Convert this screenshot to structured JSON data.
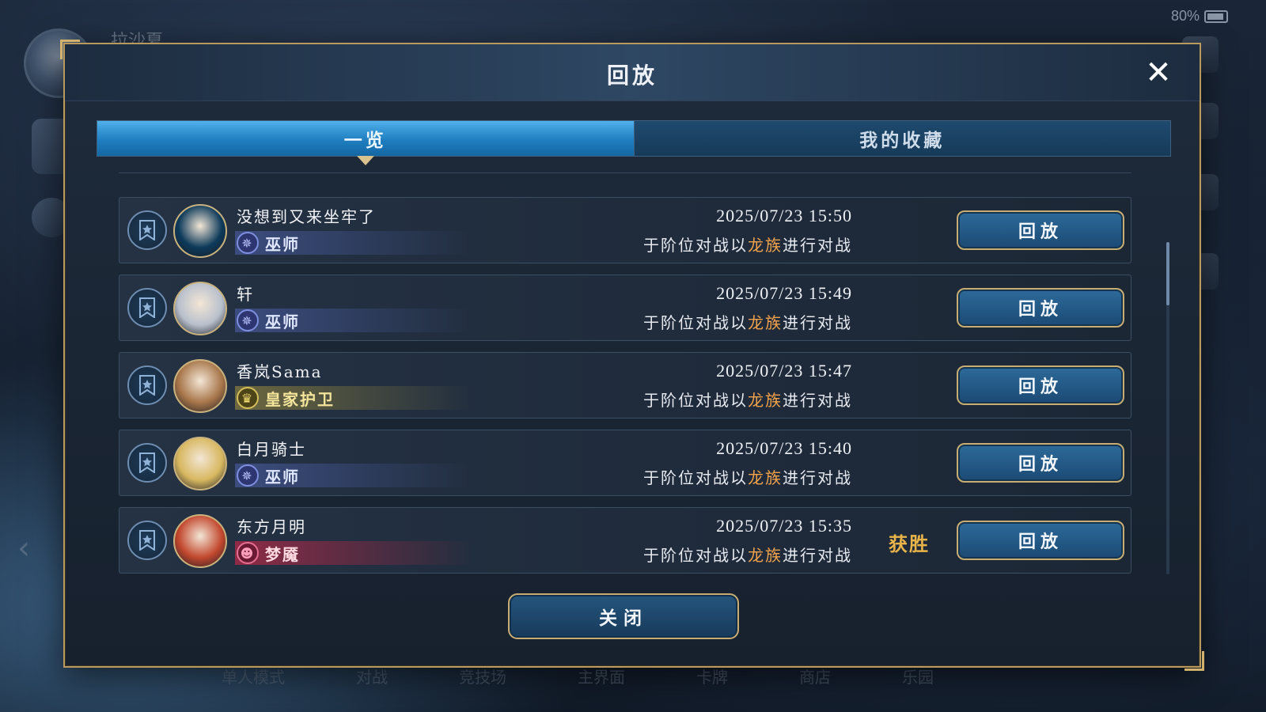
{
  "status": {
    "battery": "80%"
  },
  "background": {
    "username": "拉沙夏",
    "nav": [
      "单人模式",
      "对战",
      "竞技场",
      "主界面",
      "卡牌",
      "商店",
      "乐园"
    ]
  },
  "dialog": {
    "title": "回放",
    "close_icon": "close-icon",
    "tabs": [
      {
        "label": "一览",
        "active": true
      },
      {
        "label": "我的收藏",
        "active": false
      }
    ],
    "rows": [
      {
        "player": "没想到又来坐牢了",
        "class_name": "巫师",
        "class_type": "wizard",
        "datetime": "2025/07/23  15:50",
        "desc_prefix": "于阶位对战以",
        "deck": "龙族",
        "desc_suffix": "进行对战",
        "result": "",
        "replay_label": "回放",
        "portrait_color": "#0d3a5a"
      },
      {
        "player": "轩",
        "class_name": "巫师",
        "class_type": "wizard",
        "datetime": "2025/07/23  15:49",
        "desc_prefix": "于阶位对战以",
        "deck": "龙族",
        "desc_suffix": "进行对战",
        "result": "",
        "replay_label": "回放",
        "portrait_color": "#b8c0cc"
      },
      {
        "player": "香岚Sama",
        "class_name": "皇家护卫",
        "class_type": "royal",
        "datetime": "2025/07/23  15:47",
        "desc_prefix": "于阶位对战以",
        "deck": "龙族",
        "desc_suffix": "进行对战",
        "result": "",
        "replay_label": "回放",
        "portrait_color": "#a8764a"
      },
      {
        "player": "白月骑士",
        "class_name": "巫师",
        "class_type": "wizard",
        "datetime": "2025/07/23  15:40",
        "desc_prefix": "于阶位对战以",
        "deck": "龙族",
        "desc_suffix": "进行对战",
        "result": "",
        "replay_label": "回放",
        "portrait_color": "#d8b860"
      },
      {
        "player": "东方月明",
        "class_name": "梦魇",
        "class_type": "night",
        "datetime": "2025/07/23  15:35",
        "desc_prefix": "于阶位对战以",
        "deck": "龙族",
        "desc_suffix": "进行对战",
        "result": "获胜",
        "replay_label": "回放",
        "portrait_color": "#c2482e"
      }
    ],
    "close_button_label": "关闭"
  }
}
